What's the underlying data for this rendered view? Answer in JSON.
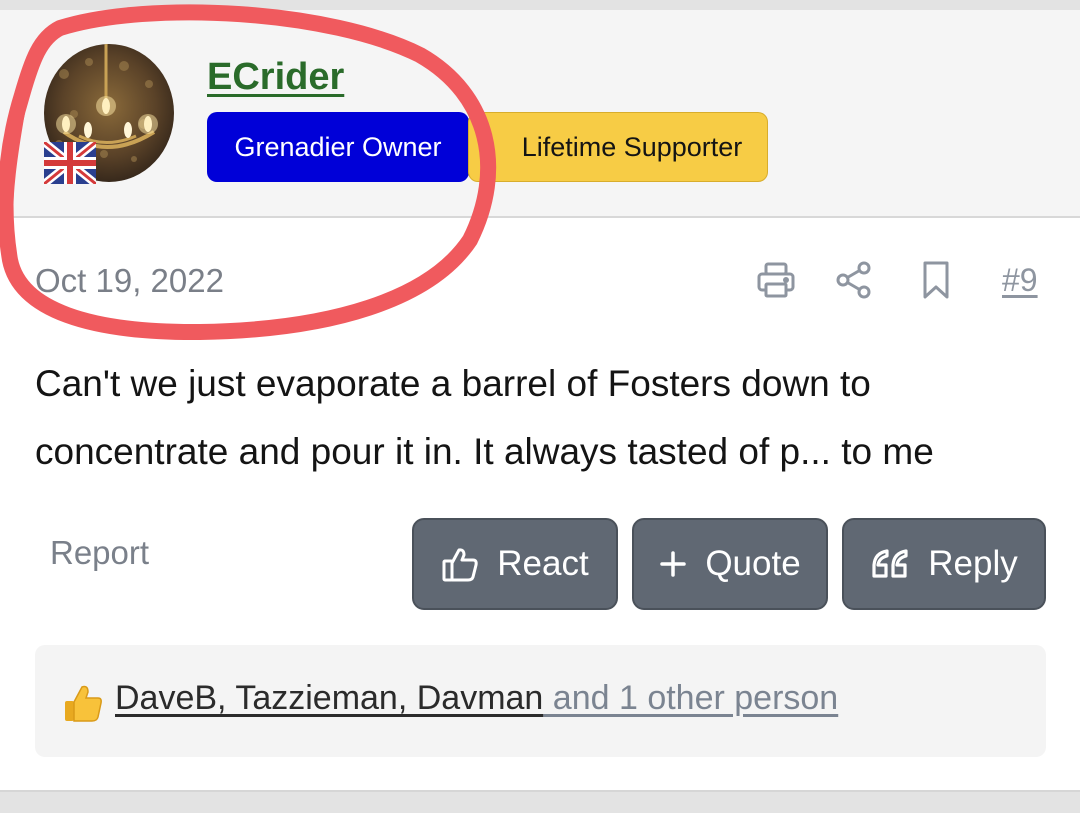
{
  "post": {
    "author": {
      "username": "ECrider",
      "avatar_icon": "chandelier-avatar",
      "flag_icon": "uk-flag-icon",
      "badges": [
        {
          "label": "Grenadier Owner",
          "color": "#0000d8"
        },
        {
          "label": "Lifetime Supporter",
          "color": "#f7cc45"
        }
      ]
    },
    "date": "Oct 19, 2022",
    "number": "#9",
    "actions": {
      "print_icon": "print-icon",
      "share_icon": "share-icon",
      "bookmark_icon": "bookmark-icon"
    },
    "message_lines": [
      "Can't we just evaporate a barrel of Fosters down to",
      "concentrate and pour it in. It always tasted of p... to me"
    ],
    "report_label": "Report",
    "buttons": {
      "react": "React",
      "quote": "Quote",
      "reply": "Reply"
    },
    "reactions": {
      "icon": "thumbs-up-emoji",
      "users": "DaveB, Tazzieman, Davman",
      "others": " and 1 other person"
    }
  },
  "annotation": {
    "color": "#f05a5e"
  }
}
